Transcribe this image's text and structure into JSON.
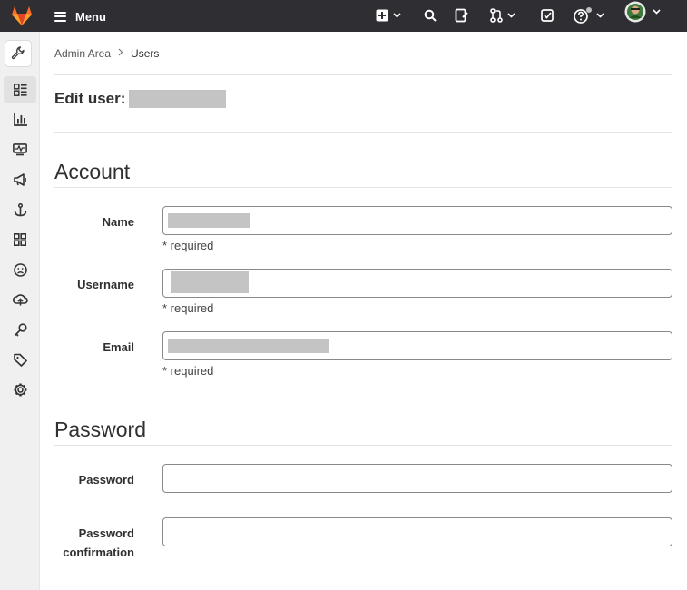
{
  "topbar": {
    "menu_label": "Menu",
    "icons": [
      "tanuki-logo",
      "menu-icon",
      "plus-square-icon",
      "search-icon",
      "issues-icon",
      "merge-request-icon",
      "todo-icon",
      "help-icon",
      "avatar"
    ]
  },
  "sidebar": {
    "items": [
      "admin-wrench-icon",
      "overview-icon",
      "analytics-icon",
      "monitoring-icon",
      "messages-icon",
      "system-hooks-icon",
      "applications-icon",
      "abuse-reports-icon",
      "deploy-keys-icon",
      "credentials-icon",
      "labels-icon",
      "settings-icon"
    ]
  },
  "breadcrumb": {
    "parent": "Admin Area",
    "current": "Users"
  },
  "page": {
    "title": "Edit user:"
  },
  "account": {
    "heading": "Account",
    "name_label": "Name",
    "username_label": "Username",
    "email_label": "Email",
    "required_hint": "* required"
  },
  "password": {
    "heading": "Password",
    "password_label": "Password",
    "confirmation_label_line1": "Password",
    "confirmation_label_line2": "confirmation"
  },
  "colors": {
    "topbar_bg": "#2f2f33",
    "sidebar_bg": "#f0f0f0",
    "logo_orange": "#fc6d26",
    "logo_red": "#e24329",
    "logo_yellow": "#fca326",
    "redaction_gray": "#c4c4c4"
  }
}
